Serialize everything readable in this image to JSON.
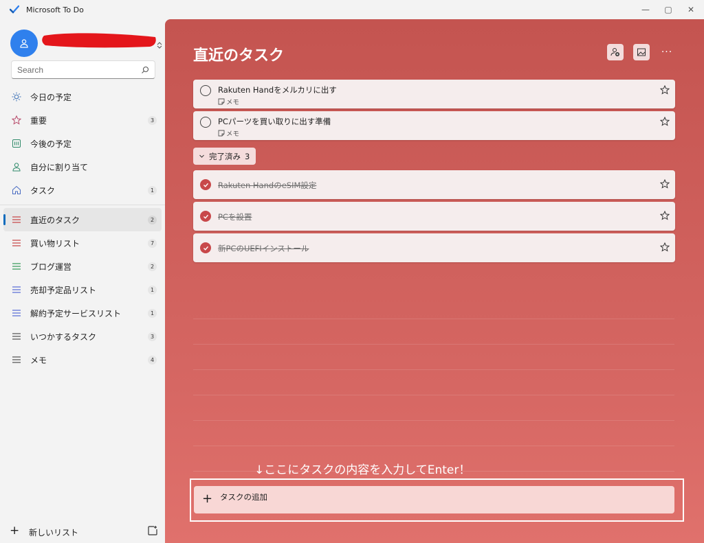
{
  "window": {
    "title": "Microsoft To Do",
    "minimize_glyph": "—",
    "maximize_glyph": "▢",
    "close_glyph": "✕"
  },
  "sidebar": {
    "search_placeholder": "Search",
    "items": [
      {
        "label": "今日の予定",
        "icon": "sun-icon",
        "count": ""
      },
      {
        "label": "重要",
        "icon": "star-icon",
        "count": "3"
      },
      {
        "label": "今後の予定",
        "icon": "calendar-icon",
        "count": ""
      },
      {
        "label": "自分に割り当て",
        "icon": "person-icon",
        "count": ""
      },
      {
        "label": "タスク",
        "icon": "home-icon",
        "count": "1"
      }
    ],
    "lists": [
      {
        "label": "直近のタスク",
        "icon": "list-icon",
        "count": "2",
        "color": "#c8484a",
        "selected": true
      },
      {
        "label": "買い物リスト",
        "icon": "list-icon",
        "count": "7",
        "color": "#c8484a"
      },
      {
        "label": "ブログ運営",
        "icon": "list-icon",
        "count": "2",
        "color": "#3a9a5b"
      },
      {
        "label": "売却予定品リスト",
        "icon": "list-icon",
        "count": "1",
        "color": "#5b6fd6"
      },
      {
        "label": "解約予定サービスリスト",
        "icon": "list-icon",
        "count": "1",
        "color": "#5b6fd6"
      },
      {
        "label": "いつかするタスク",
        "icon": "list-icon",
        "count": "3",
        "color": "#555555"
      },
      {
        "label": "メモ",
        "icon": "list-icon",
        "count": "4",
        "color": "#555555"
      }
    ],
    "new_list_label": "新しいリスト"
  },
  "main": {
    "title": "直近のタスク",
    "more_glyph": "···",
    "tasks": [
      {
        "title": "Rakuten Handをメルカリに出す",
        "note": "メモ"
      },
      {
        "title": "PCパーツを買い取りに出す準備",
        "note": "メモ"
      }
    ],
    "completed_label": "完了済み",
    "completed_count": "3",
    "completed_tasks": [
      {
        "title": "Rakuten HandのeSIM設定"
      },
      {
        "title": "PCを設置"
      },
      {
        "title": "新PCのUEFIインストール"
      }
    ],
    "hint": "↓ここにタスクの内容を入力してEnter！",
    "add_task_placeholder": "タスクの追加",
    "add_plus_glyph": "+"
  },
  "colors": {
    "accent": "#0f6cbd",
    "theme": "#c8484a",
    "avatar": "#2f80ed"
  }
}
